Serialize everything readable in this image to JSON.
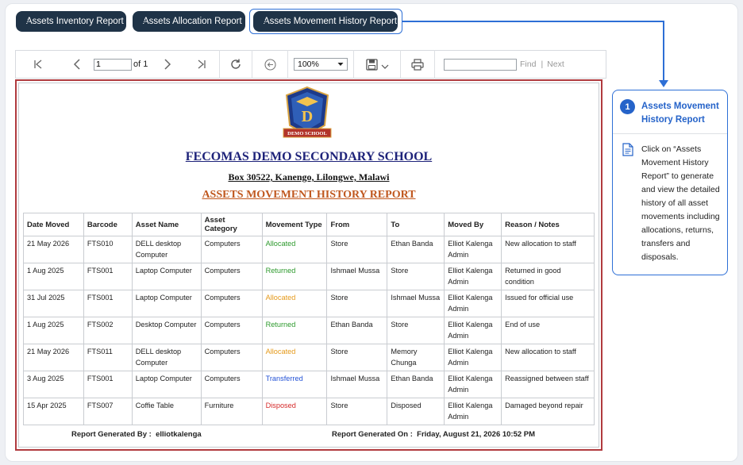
{
  "tabs": [
    {
      "label": "Assets Inventory Report"
    },
    {
      "label": "Assets Allocation Report"
    },
    {
      "label": "Assets Movement History Report"
    }
  ],
  "toolbar": {
    "page_value": "1",
    "of_label": "of 1",
    "zoom": "100%",
    "find_label": "Find",
    "separator": "|",
    "next_label": "Next"
  },
  "report": {
    "school_name": "FECOMAS DEMO SECONDARY SCHOOL",
    "address": "Box 30522, Kanengo, Lilongwe, Malawi",
    "title": "ASSETS MOVEMENT HISTORY REPORT",
    "logo_text": "DEMO SCHOOL",
    "columns": [
      "Date Moved",
      "Barcode",
      "Asset Name",
      "Asset Category",
      "Movement Type",
      "From",
      "To",
      "Moved By",
      "Reason / Notes"
    ],
    "rows": [
      {
        "date": "21 May 2026",
        "barcode": "FTS010",
        "asset": "DELL desktop Computer",
        "category": "Computers",
        "type": "Allocated",
        "from": "Store",
        "to": "Ethan Banda",
        "by": "Elliot Kalenga Admin",
        "reason": "New allocation to staff"
      },
      {
        "date": "1 Aug 2025",
        "barcode": "FTS001",
        "asset": "Laptop Computer",
        "category": "Computers",
        "type": "Returned",
        "from": "Ishmael Mussa",
        "to": "Store",
        "by": "Elliot Kalenga Admin",
        "reason": "Returned in good condition"
      },
      {
        "date": "31 Jul 2025",
        "barcode": "FTS001",
        "asset": "Laptop Computer",
        "category": "Computers",
        "type": "Allocated",
        "from": "Store",
        "to": "Ishmael Mussa",
        "by": "Elliot Kalenga Admin",
        "reason": "Issued for official use"
      },
      {
        "date": "1 Aug 2025",
        "barcode": "FTS002",
        "asset": "Desktop Computer",
        "category": "Computers",
        "type": "Returned",
        "from": "Ethan Banda",
        "to": "Store",
        "by": "Elliot Kalenga Admin",
        "reason": "End of use"
      },
      {
        "date": "21 May 2026",
        "barcode": "FTS011",
        "asset": "DELL desktop Computer",
        "category": "Computers",
        "type": "Allocated",
        "from": "Store",
        "to": "Memory Chunga",
        "by": "Elliot Kalenga Admin",
        "reason": "New allocation to staff"
      },
      {
        "date": "3 Aug 2025",
        "barcode": "FTS001",
        "asset": "Laptop Computer",
        "category": "Computers",
        "type": "Transferred",
        "from": "Ishmael Mussa",
        "to": "Ethan Banda",
        "by": "Elliot Kalenga Admin",
        "reason": "Reassigned between staff"
      },
      {
        "date": "15 Apr 2025",
        "barcode": "FTS007",
        "asset": "Coffie Table",
        "category": "Furniture",
        "type": "Disposed",
        "from": "Store",
        "to": "Disposed",
        "by": "Elliot Kalenga Admin",
        "reason": "Damaged beyond repair"
      }
    ],
    "footer_generated_by_label": "Report Generated By :",
    "footer_generated_by": "elliotkalenga",
    "footer_generated_on_label": "Report Generated On :",
    "footer_generated_on": "Friday, August 21, 2026 10:52 PM"
  },
  "movement_colors": {
    "Allocated": "#2e9a2e",
    "Returned": "#2e9a2e",
    "Transferred": "#2453d6",
    "Disposed": "#d62b2b",
    "Allocated_alt": "#e59a1c"
  },
  "help": {
    "step": "1",
    "title": "Assets Movement History Report",
    "text": "Click on “Assets Movement History Report” to generate and view the detailed history of all asset movements including allocations, returns, transfers and disposals."
  },
  "colors": {
    "accent": "#2d6fd6",
    "tab_bg": "#1f3347",
    "school_name": "#1e237a",
    "report_title": "#c0581f",
    "report_border": "#b03a3e"
  }
}
